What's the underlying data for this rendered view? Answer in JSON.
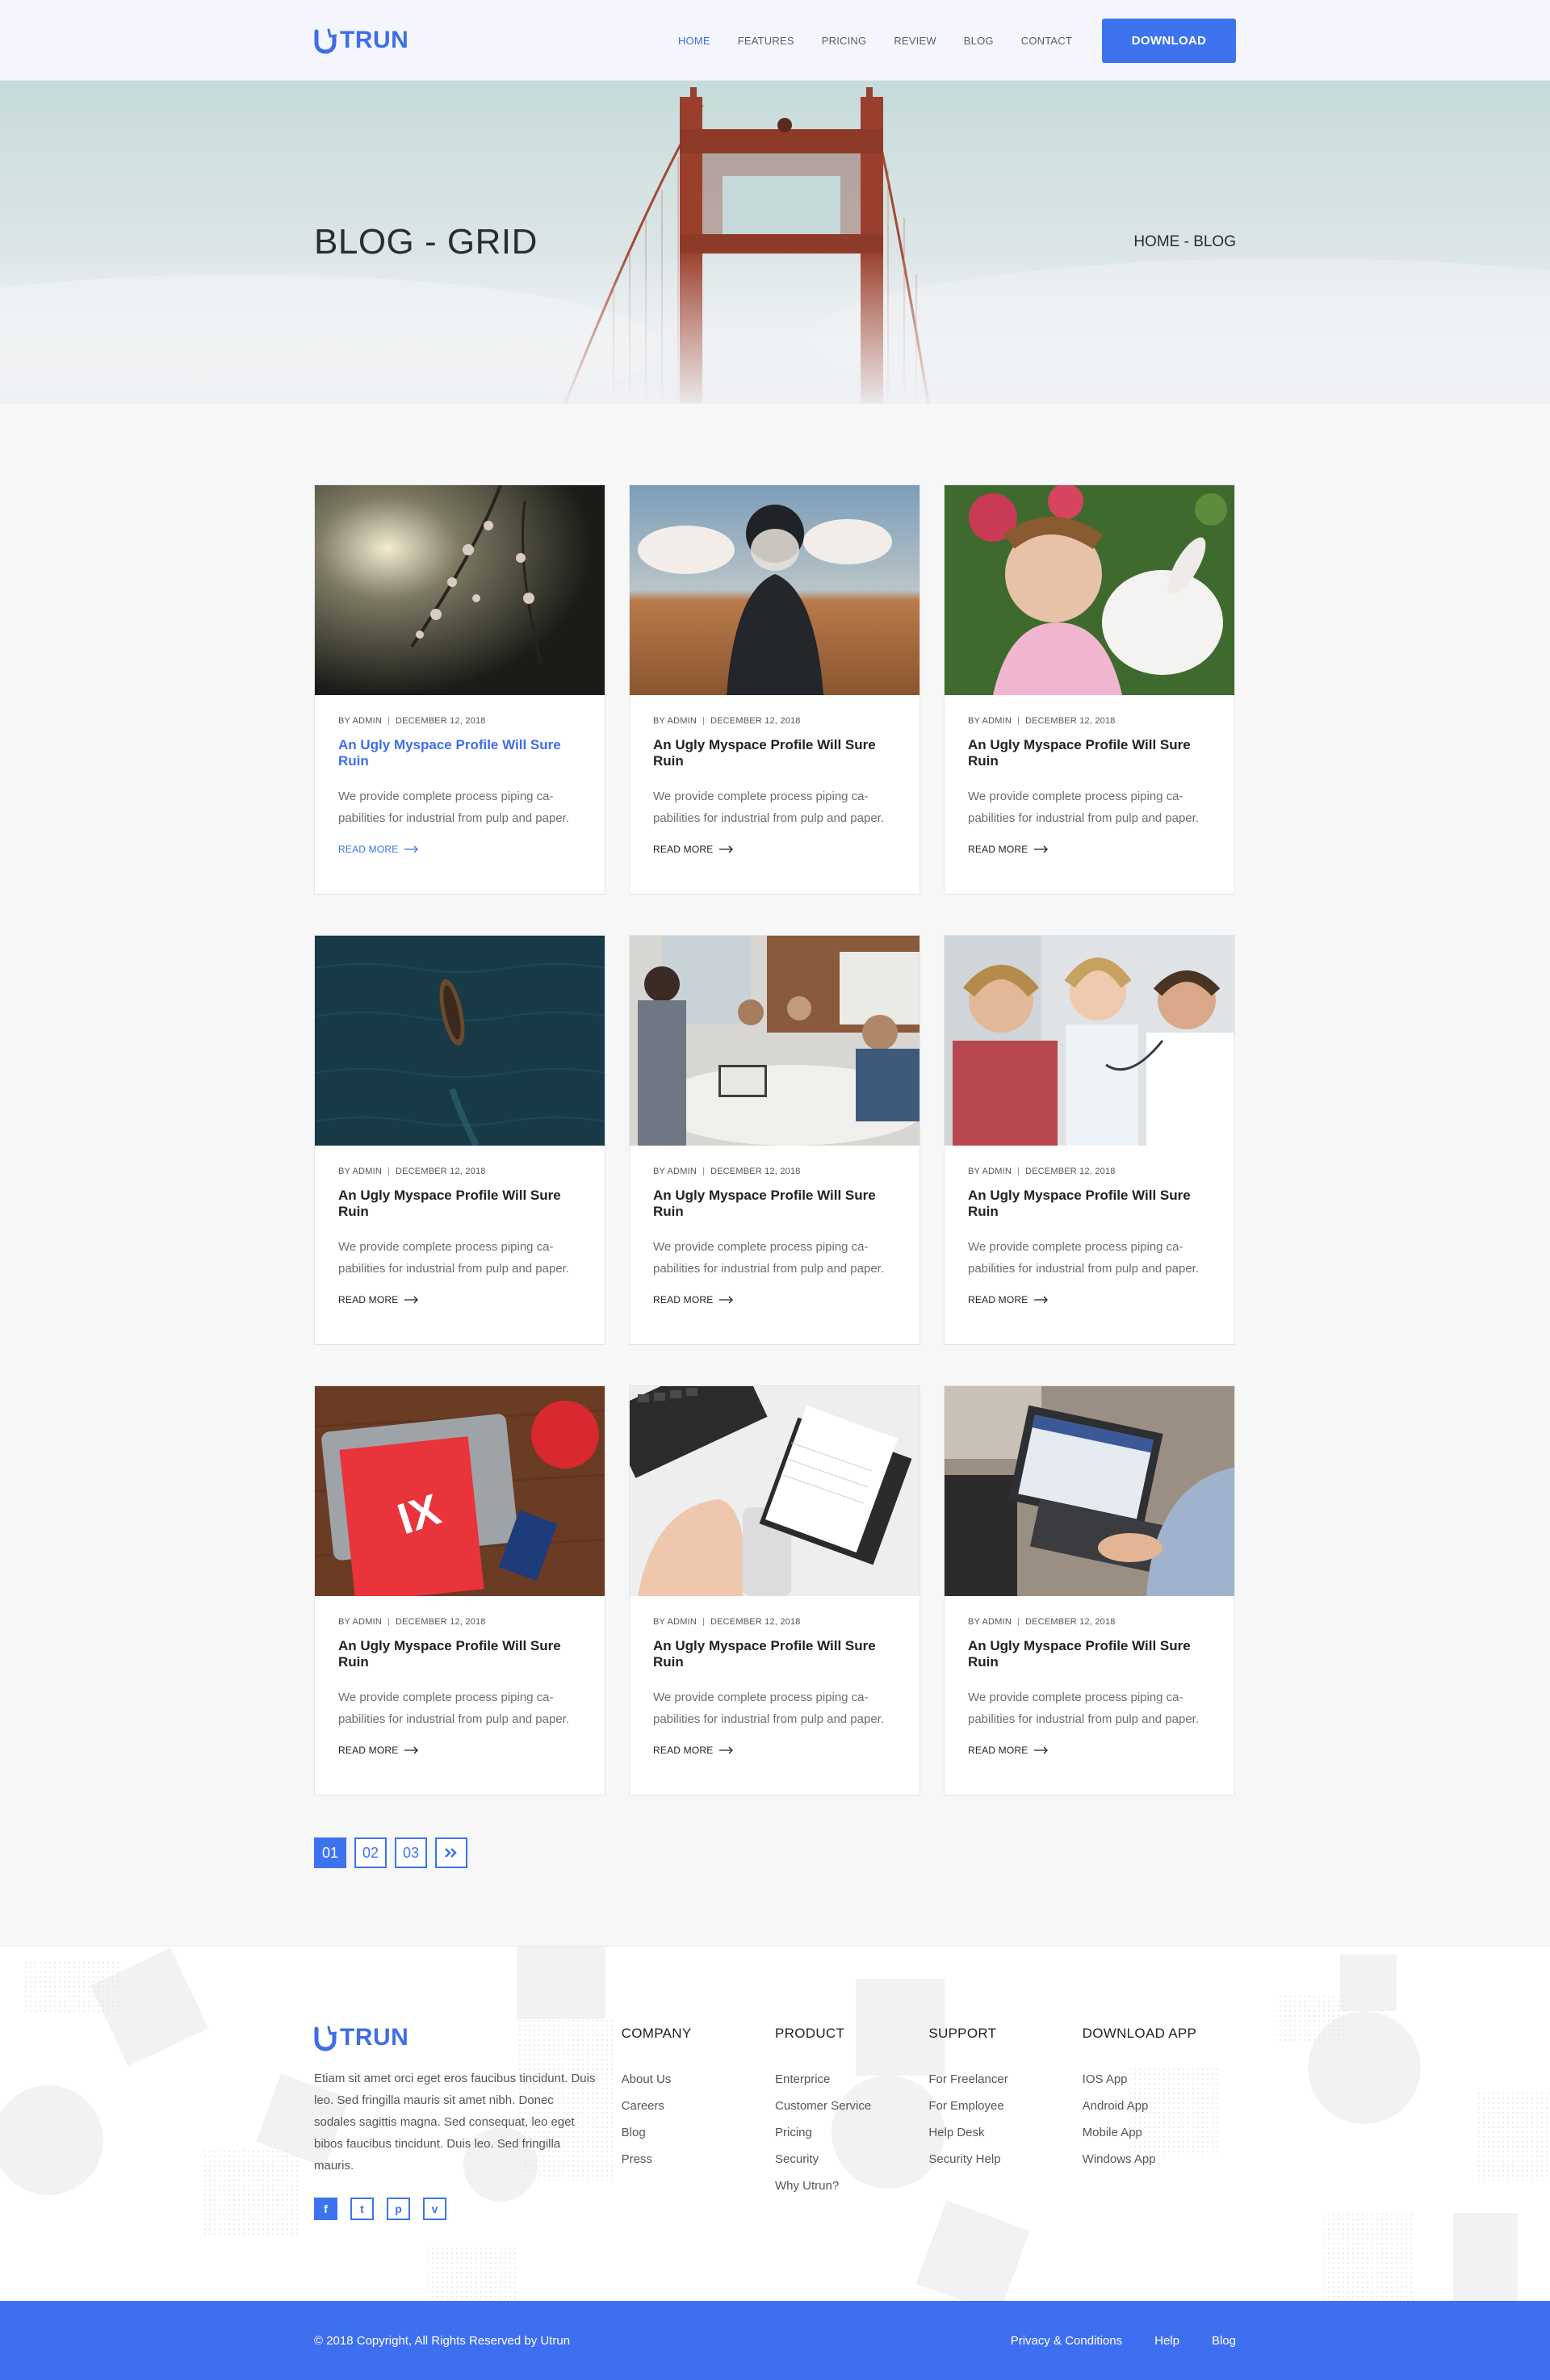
{
  "brand": {
    "name": "TRUN",
    "color": "#3e6ee8"
  },
  "nav": {
    "items": [
      {
        "label": "HOME",
        "active": true
      },
      {
        "label": "FEATURES"
      },
      {
        "label": "PRICING"
      },
      {
        "label": "REVIEW"
      },
      {
        "label": "BLOG"
      },
      {
        "label": "CONTACT"
      }
    ],
    "download_label": "DOWNLOAD"
  },
  "hero": {
    "title": "BLOG - GRID",
    "breadcrumb": "HOME - BLOG"
  },
  "posts": [
    {
      "author": "BY ADMIN",
      "date": "DECEMBER 12, 2018",
      "title": "An Ugly Myspace Profile Will Sure Ruin",
      "desc": "We provide complete process piping ca-pabilities for industrial from pulp and paper.",
      "read_more": "READ MORE",
      "image": "blossom-photo"
    },
    {
      "author": "BY ADMIN",
      "date": "DECEMBER 12, 2018",
      "title": "An Ugly Myspace Profile Will Sure Ruin",
      "desc": "We provide complete process piping ca-pabilities for industrial from pulp and paper.",
      "read_more": "READ MORE",
      "image": "field-girl-photo"
    },
    {
      "author": "BY ADMIN",
      "date": "DECEMBER 12, 2018",
      "title": "An Ugly Myspace Profile Will Sure Ruin",
      "desc": "We provide complete process piping ca-pabilities for industrial from pulp and paper.",
      "read_more": "READ MORE",
      "image": "girl-bunny-photo"
    },
    {
      "author": "BY ADMIN",
      "date": "DECEMBER 12, 2018",
      "title": "An Ugly Myspace Profile Will Sure Ruin",
      "desc": "We provide complete process piping ca-pabilities for industrial from pulp and paper.",
      "read_more": "READ MORE",
      "image": "boat-sea-photo"
    },
    {
      "author": "BY ADMIN",
      "date": "DECEMBER 12, 2018",
      "title": "An Ugly Myspace Profile Will Sure Ruin",
      "desc": "We provide complete process piping ca-pabilities for industrial from pulp and paper.",
      "read_more": "READ MORE",
      "image": "office-meeting-photo"
    },
    {
      "author": "BY ADMIN",
      "date": "DECEMBER 12, 2018",
      "title": "An Ugly Myspace Profile Will Sure Ruin",
      "desc": "We provide complete process piping ca-pabilities for industrial from pulp and paper.",
      "read_more": "READ MORE",
      "image": "doctor-child-photo"
    },
    {
      "author": "BY ADMIN",
      "date": "DECEMBER 12, 2018",
      "title": "An Ugly Myspace Profile Will Sure Ruin",
      "desc": "We provide complete process piping ca-pabilities for industrial from pulp and paper.",
      "read_more": "READ MORE",
      "image": "notebook-desk-photo"
    },
    {
      "author": "BY ADMIN",
      "date": "DECEMBER 12, 2018",
      "title": "An Ugly Myspace Profile Will Sure Ruin",
      "desc": "We provide complete process piping ca-pabilities for industrial from pulp and paper.",
      "read_more": "READ MORE",
      "image": "workspace-photo"
    },
    {
      "author": "BY ADMIN",
      "date": "DECEMBER 12, 2018",
      "title": "An Ugly Myspace Profile Will Sure Ruin",
      "desc": "We provide complete process piping ca-pabilities for industrial from pulp and paper.",
      "read_more": "READ MORE",
      "image": "laptop-typing-photo"
    }
  ],
  "pagination": {
    "pages": [
      "01",
      "02",
      "03"
    ],
    "next_icon": "double-chevron-right-icon"
  },
  "footer": {
    "about": "Etiam sit amet orci eget eros faucibus tincidunt. Duis leo. Sed fringilla mauris sit amet nibh. Donec sodales sagittis magna. Sed consequat, leo eget bibos faucibus tincidunt. Duis leo. Sed fringilla mauris.",
    "social": [
      "f",
      "t",
      "p",
      "v"
    ],
    "columns": [
      {
        "title": "COMPANY",
        "links": [
          "About Us",
          "Careers",
          "Blog",
          "Press"
        ]
      },
      {
        "title": "PRODUCT",
        "links": [
          "Enterprice",
          "Customer Service",
          "Pricing",
          "Security",
          "Why Utrun?"
        ]
      },
      {
        "title": "SUPPORT",
        "links": [
          "For Freelancer",
          "For Employee",
          "Help Desk",
          "Security Help"
        ]
      },
      {
        "title": "DOWNLOAD APP",
        "links": [
          "IOS App",
          "Android App",
          "Mobile App",
          "Windows App"
        ]
      }
    ],
    "copyright": "© 2018 Copyright, All Rights Reserved by Utrun",
    "bottom_links": [
      "Privacy & Conditions",
      "Help",
      "Blog"
    ]
  },
  "colors": {
    "accent": "#3e73f0",
    "bottom_bar": "#3e6ff0"
  }
}
